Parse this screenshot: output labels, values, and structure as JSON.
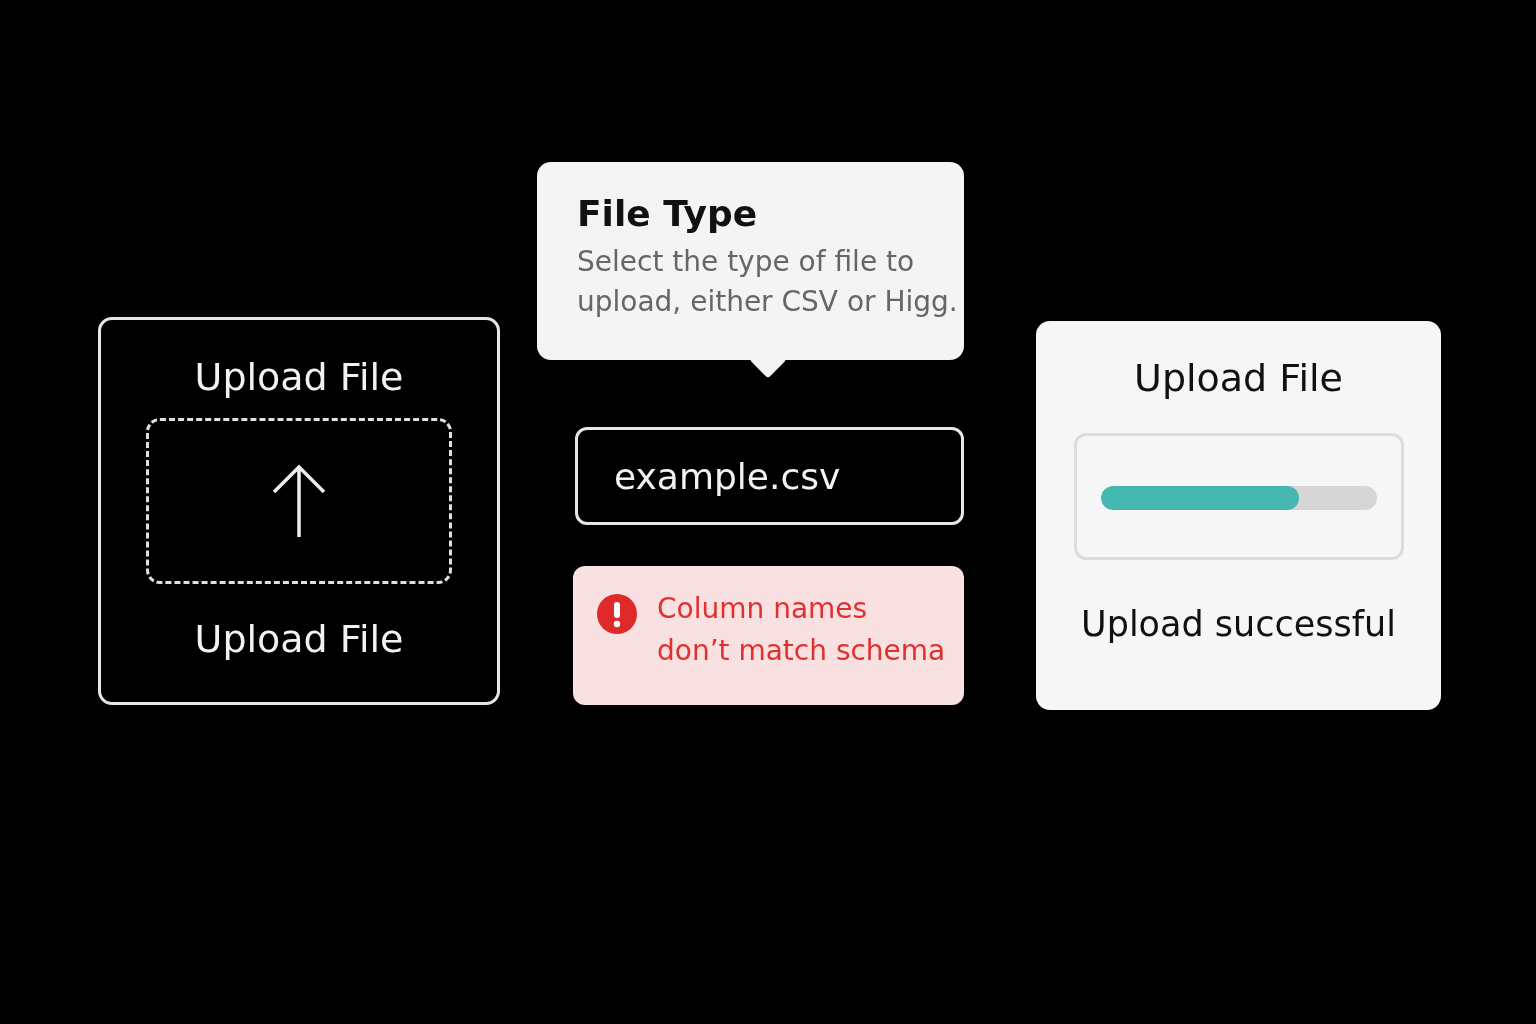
{
  "upload_card": {
    "title": "Upload File",
    "dropzone_label": "Upload File"
  },
  "tooltip": {
    "title": "File Type",
    "text": "Select the type of file to\nupload, either CSV or Higg."
  },
  "file_field": {
    "value": "example.csv"
  },
  "error": {
    "message": "Column names\ndon’t match schema"
  },
  "progress_card": {
    "title": "Upload File",
    "progress": {
      "level": 0.72
    },
    "status": "Upload successful"
  }
}
